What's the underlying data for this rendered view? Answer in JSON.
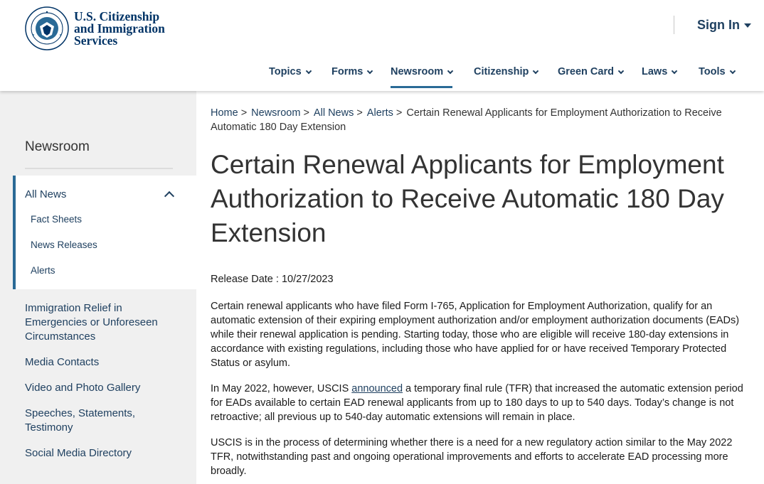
{
  "brand": {
    "line1": "U.S. Citizenship",
    "line2": "and Immigration",
    "line3": "Services",
    "colors": {
      "primary": "#003366",
      "link": "#1f4060",
      "accent": "#2a6a96"
    }
  },
  "header": {
    "sign_in": "Sign In"
  },
  "nav": [
    {
      "label": "Topics"
    },
    {
      "label": "Forms"
    },
    {
      "label": "Newsroom",
      "active": true
    },
    {
      "label": "Citizenship"
    },
    {
      "label": "Green Card"
    },
    {
      "label": "Laws"
    },
    {
      "label": "Tools"
    }
  ],
  "sidebar": {
    "title": "Newsroom",
    "group": {
      "label": "All News",
      "items": [
        "Fact Sheets",
        "News Releases",
        "Alerts"
      ]
    },
    "links": [
      "Immigration Relief in Emergencies or Unforeseen Circumstances",
      "Media Contacts",
      "Video and Photo Gallery",
      "Speeches, Statements, Testimony",
      "Social Media Directory"
    ]
  },
  "breadcrumb": {
    "items": [
      "Home",
      "Newsroom",
      "All News",
      "Alerts"
    ],
    "separator": ">",
    "current": "Certain Renewal Applicants for Employment Authorization to Receive Automatic 180 Day Extension"
  },
  "article": {
    "title": "Certain Renewal Applicants for Employment Authorization to Receive Automatic 180 Day Extension",
    "release_label": "Release Date :",
    "release_date": "10/27/2023",
    "p1": "Certain renewal applicants who have filed Form I-765, Application for Employment Authorization, qualify for an automatic extension of their expiring employment authorization and/or employment authorization documents (EADs) while their renewal application is pending. Starting today, those who are eligible will receive 180-day extensions in accordance with existing regulations, including those who have applied for or have received Temporary Protected Status or asylum.",
    "p2_before": "In May 2022, however, USCIS ",
    "p2_link": "announced",
    "p2_after": " a temporary final rule (TFR) that increased the automatic extension period for EADs available to certain EAD renewal applicants from up to 180 days to up to 540 days. Today’s change is not retroactive; all previous up to 540-day automatic extensions will remain in place.",
    "p3": "USCIS is in the process of determining whether there is a need for a new regulatory action similar to the May 2022 TFR, notwithstanding past and ongoing operational improvements and efforts to accelerate EAD processing more broadly."
  }
}
